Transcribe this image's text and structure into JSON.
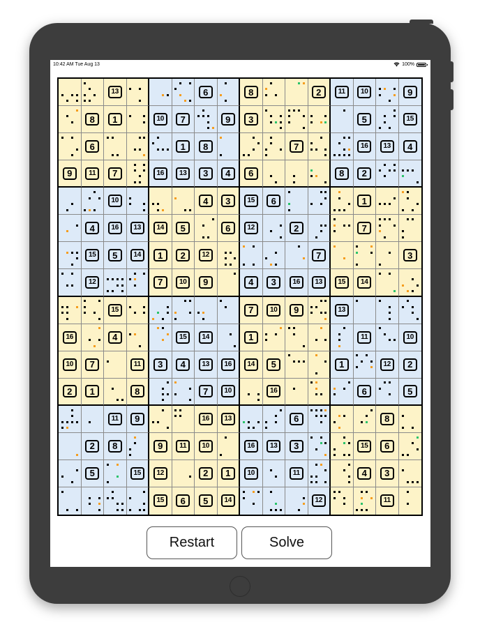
{
  "status_bar": {
    "time": "10:42 AM  Tue Aug 13",
    "battery": "100%"
  },
  "board": {
    "size": 16,
    "box_size": 4,
    "givens": [
      [
        "",
        "",
        "13",
        "",
        "",
        "",
        "6",
        "",
        "8",
        "",
        "",
        "2",
        "11",
        "10",
        "",
        "9"
      ],
      [
        "",
        "8",
        "1",
        "",
        "10",
        "7",
        "",
        "9",
        "3",
        "",
        "",
        "",
        "",
        "5",
        "",
        "15"
      ],
      [
        "",
        "6",
        "",
        "",
        "",
        "1",
        "8",
        "",
        "",
        "",
        "7",
        "",
        "",
        "16",
        "13",
        "4"
      ],
      [
        "9",
        "11",
        "7",
        "",
        "16",
        "13",
        "3",
        "4",
        "6",
        "",
        "",
        "",
        "8",
        "2",
        "",
        ""
      ],
      [
        "",
        "",
        "10",
        "",
        "",
        "",
        "4",
        "3",
        "15",
        "6",
        "",
        "",
        "",
        "1",
        "",
        ""
      ],
      [
        "",
        "4",
        "16",
        "13",
        "14",
        "5",
        "",
        "6",
        "12",
        "",
        "2",
        "",
        "",
        "7",
        "",
        ""
      ],
      [
        "",
        "15",
        "5",
        "14",
        "1",
        "2",
        "12",
        "",
        "",
        "",
        "",
        "7",
        "",
        "",
        "",
        "3"
      ],
      [
        "",
        "12",
        "",
        "",
        "7",
        "10",
        "9",
        "",
        "4",
        "3",
        "16",
        "13",
        "15",
        "14",
        "",
        ""
      ],
      [
        "",
        "",
        "15",
        "",
        "",
        "",
        "",
        "",
        "7",
        "10",
        "9",
        "",
        "13",
        "",
        "",
        ""
      ],
      [
        "16",
        "",
        "4",
        "",
        "",
        "15",
        "14",
        "",
        "1",
        "",
        "",
        "",
        "",
        "11",
        "",
        "10"
      ],
      [
        "10",
        "7",
        "",
        "11",
        "3",
        "4",
        "13",
        "16",
        "14",
        "5",
        "",
        "",
        "1",
        "",
        "12",
        "2"
      ],
      [
        "2",
        "1",
        "",
        "8",
        "",
        "",
        "7",
        "10",
        "",
        "16",
        "",
        "",
        "",
        "6",
        "",
        "5"
      ],
      [
        "",
        "",
        "11",
        "9",
        "",
        "",
        "16",
        "13",
        "",
        "",
        "6",
        "",
        "",
        "",
        "8",
        ""
      ],
      [
        "",
        "2",
        "8",
        "",
        "9",
        "11",
        "10",
        "",
        "16",
        "13",
        "3",
        "",
        "",
        "15",
        "6",
        ""
      ],
      [
        "",
        "5",
        "",
        "15",
        "12",
        "",
        "2",
        "1",
        "10",
        "",
        "11",
        "",
        "",
        "4",
        "3",
        ""
      ],
      [
        "",
        "",
        "",
        "",
        "15",
        "6",
        "5",
        "14",
        "",
        "",
        "",
        "12",
        "",
        "",
        "11",
        ""
      ]
    ],
    "colors": {
      "box_yellow": "#fdf3c8",
      "box_blue": "#ddeaf8",
      "candidate_black": "#000000",
      "candidate_orange": "#f59d1e",
      "candidate_green": "#2bc36b"
    }
  },
  "actions": {
    "restart_label": "Restart",
    "solve_label": "Solve"
  }
}
